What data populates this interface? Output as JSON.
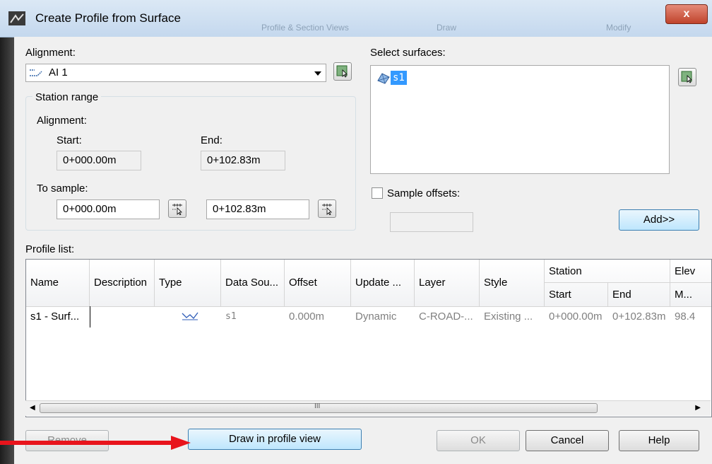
{
  "window": {
    "title": "Create Profile from Surface",
    "close_label": "x"
  },
  "background_tabs": [
    "Profile & Section Views",
    "Draw",
    "Modify"
  ],
  "alignment": {
    "label": "Alignment:",
    "selected": "AI 1"
  },
  "station_range": {
    "title": "Station range",
    "alignment_label": "Alignment:",
    "start_label": "Start:",
    "end_label": "End:",
    "start_value": "0+000.00m",
    "end_value": "0+102.83m",
    "to_sample_label": "To sample:",
    "sample_start": "0+000.00m",
    "sample_end": "0+102.83m"
  },
  "surfaces": {
    "label": "Select surfaces:",
    "items": [
      "s1"
    ]
  },
  "sample_offsets": {
    "label": "Sample offsets:",
    "checked": false,
    "value": ""
  },
  "add_button": "Add>>",
  "profile_list": {
    "label": "Profile list:",
    "columns": [
      "Name",
      "Description",
      "Type",
      "Data Sou...",
      "Offset",
      "Update ...",
      "Layer",
      "Style"
    ],
    "station_group": "Station",
    "station_start": "Start",
    "station_end": "End",
    "elev_group": "Elev",
    "elev_sub": "M...",
    "rows": [
      {
        "name": "s1 - Surf...",
        "description": "",
        "type": "profile-line-icon",
        "data_source": "s1",
        "offset": "0.000m",
        "update": "Dynamic",
        "layer": "C-ROAD-...",
        "style": "Existing ...",
        "start": "0+000.00m",
        "end": "0+102.83m",
        "elev": "98.4"
      }
    ],
    "scroll_grip": "III"
  },
  "buttons": {
    "remove": "Remove",
    "draw_in_profile_view": "Draw in profile view",
    "ok": "OK",
    "cancel": "Cancel",
    "help": "Help"
  },
  "colors": {
    "annotation_arrow": "#e8141c",
    "selection": "#3399ff"
  }
}
